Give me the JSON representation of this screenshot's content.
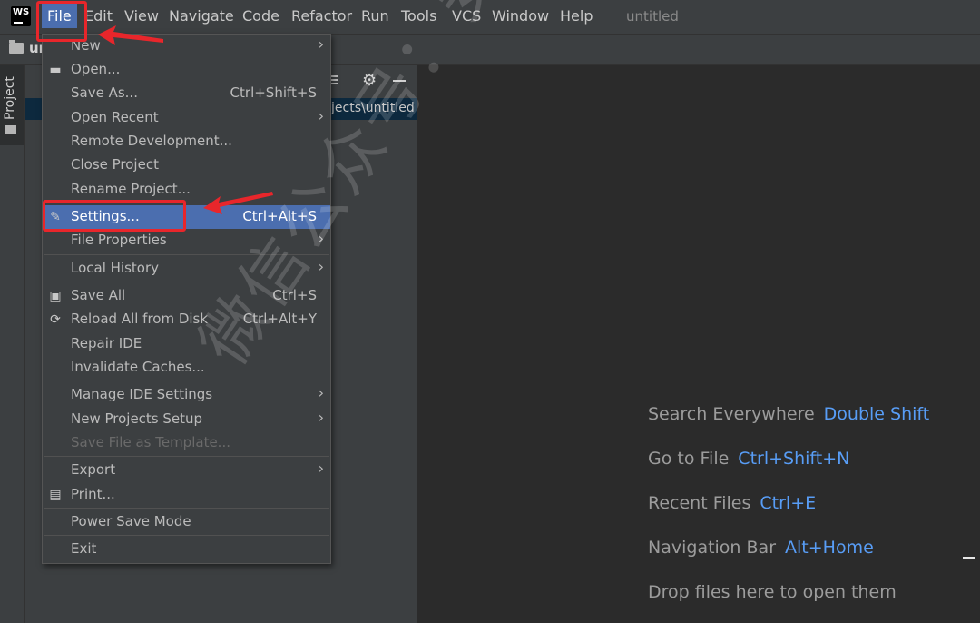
{
  "app": {
    "logo_text": "WS",
    "window_title": "untitled",
    "project_name_short": "un"
  },
  "menubar": [
    {
      "label": "File",
      "active": true
    },
    {
      "label": "Edit"
    },
    {
      "label": "View"
    },
    {
      "label": "Navigate"
    },
    {
      "label": "Code"
    },
    {
      "label": "Refactor"
    },
    {
      "label": "Run"
    },
    {
      "label": "Tools"
    },
    {
      "label": "VCS"
    },
    {
      "label": "Window"
    },
    {
      "label": "Help"
    }
  ],
  "tool_strip": {
    "project_tab_label": "Project"
  },
  "project_panel": {
    "path_text": "jects\\untitled"
  },
  "file_menu": {
    "items": [
      {
        "label": "New",
        "submenu": true,
        "icon": ""
      },
      {
        "label": "Open...",
        "icon": "folder-open-icon"
      },
      {
        "label": "Save As...",
        "shortcut": "Ctrl+Shift+S"
      },
      {
        "label": "Open Recent",
        "submenu": true
      },
      {
        "label": "Remote Development..."
      },
      {
        "label": "Close Project"
      },
      {
        "label": "Rename Project..."
      },
      {
        "label": "Settings...",
        "shortcut": "Ctrl+Alt+S",
        "selected": true,
        "icon": "wrench-icon"
      },
      {
        "label": "File Properties",
        "submenu": true
      },
      {
        "label": "Local History",
        "submenu": true
      },
      {
        "label": "Save All",
        "shortcut": "Ctrl+S",
        "icon": "save-icon"
      },
      {
        "label": "Reload All from Disk",
        "shortcut": "Ctrl+Alt+Y",
        "icon": "reload-icon"
      },
      {
        "label": "Repair IDE"
      },
      {
        "label": "Invalidate Caches..."
      },
      {
        "label": "Manage IDE Settings",
        "submenu": true
      },
      {
        "label": "New Projects Setup",
        "submenu": true
      },
      {
        "label": "Save File as Template...",
        "disabled": true
      },
      {
        "label": "Export",
        "submenu": true
      },
      {
        "label": "Print...",
        "icon": "print-icon"
      },
      {
        "label": "Power Save Mode"
      },
      {
        "label": "Exit"
      }
    ]
  },
  "editor_hints": [
    {
      "text": "Search Everywhere",
      "key": "Double Shift"
    },
    {
      "text": "Go to File",
      "key": "Ctrl+Shift+N"
    },
    {
      "text": "Recent Files",
      "key": "Ctrl+E"
    },
    {
      "text": "Navigation Bar",
      "key": "Alt+Home"
    },
    {
      "text": "Drop files here to open them",
      "key": ""
    }
  ],
  "watermark": "微信公众号：安装软件指南",
  "colors": {
    "accent": "#4b6eaf",
    "hint_key": "#589df6",
    "annotation": "#e8262b"
  }
}
